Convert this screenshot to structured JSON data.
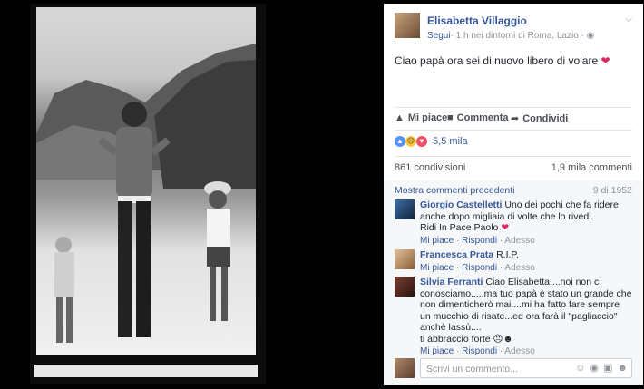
{
  "post": {
    "author": "Elisabetta Villaggio",
    "follow": "Segui",
    "meta": "· 1 h nei dintorni di Roma, Lazio · ",
    "text": "Ciao papà ora sei di nuovo libero di volare"
  },
  "actions": {
    "like": "Mi piace",
    "comment": "Commenta",
    "share": "Condividi"
  },
  "reactions": {
    "count": "5,5 mila"
  },
  "stats": {
    "shares": "861 condivisioni",
    "comments": "1,9 mila commenti"
  },
  "comments": {
    "previous": "Mostra commenti precedenti",
    "count": "9 di 1952",
    "items": [
      {
        "name": "Giorgio Castelletti",
        "text1": "Uno dei pochi che fa ridere anche dopo migliaia di volte che lo rivedi.",
        "text2": "Ridi In Pace Paolo",
        "like": "Mi piace",
        "reply": "Rispondi",
        "time": "Adesso"
      },
      {
        "name": "Francesca Prata",
        "text1": "R.I.P.",
        "like": "Mi piace",
        "reply": "Rispondi",
        "time": "Adesso"
      },
      {
        "name": "Silvia Ferranti",
        "text1": "Ciao Elisabetta....noi non ci conosciamo.....ma tuo papà è stato un grande che non dimenticherò mai....mi ha fatto fare sempre un mucchio di risate...ed ora farà il \"pagliaccio\" anchè lassù....",
        "text2": "ti abbraccio forte",
        "like": "Mi piace",
        "reply": "Rispondi",
        "time": "Adesso"
      }
    ]
  },
  "write": {
    "placeholder": "Scrivi un commento..."
  },
  "colors": {
    "link": "#365899",
    "heart": "#e0245e"
  }
}
